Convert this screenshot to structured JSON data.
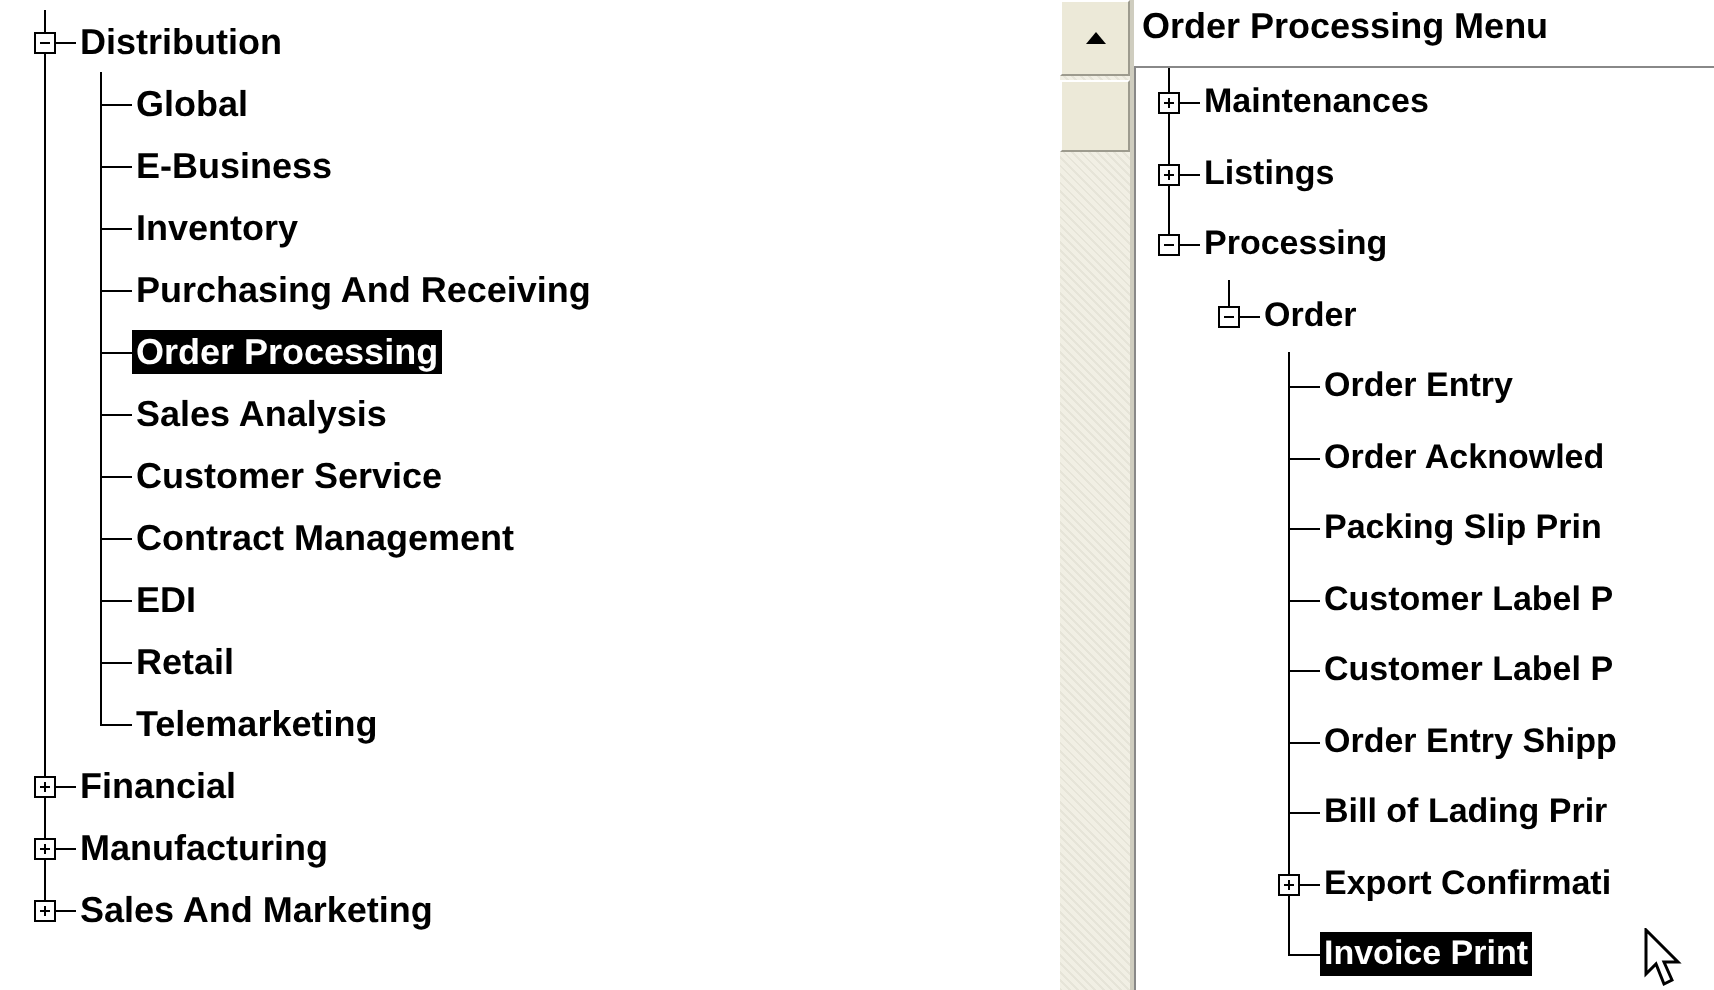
{
  "module_tree": {
    "items": [
      {
        "label": "Distribution",
        "expanded": true,
        "selected": false,
        "children": [
          {
            "label": "Global",
            "selected": false
          },
          {
            "label": "E-Business",
            "selected": false
          },
          {
            "label": "Inventory",
            "selected": false
          },
          {
            "label": "Purchasing And Receiving",
            "selected": false
          },
          {
            "label": "Order Processing",
            "selected": true
          },
          {
            "label": "Sales Analysis",
            "selected": false
          },
          {
            "label": "Customer Service",
            "selected": false
          },
          {
            "label": "Contract Management",
            "selected": false
          },
          {
            "label": "EDI",
            "selected": false
          },
          {
            "label": "Retail",
            "selected": false
          },
          {
            "label": "Telemarketing",
            "selected": false
          }
        ]
      },
      {
        "label": "Financial",
        "expanded": false,
        "selected": false
      },
      {
        "label": "Manufacturing",
        "expanded": false,
        "selected": false
      },
      {
        "label": "Sales And Marketing",
        "expanded": false,
        "selected": false
      }
    ]
  },
  "menu_panel": {
    "title": "Order Processing Menu",
    "items": [
      {
        "label": "Maintenances",
        "expanded": false,
        "selected": false
      },
      {
        "label": "Listings",
        "expanded": false,
        "selected": false
      },
      {
        "label": "Processing",
        "expanded": true,
        "selected": false,
        "children": [
          {
            "label": "Order",
            "expanded": true,
            "selected": false,
            "children": [
              {
                "label": "Order Entry",
                "selected": false
              },
              {
                "label": "Order Acknowled",
                "selected": false
              },
              {
                "label": "Packing Slip Prin",
                "selected": false
              },
              {
                "label": "Customer Label P",
                "selected": false
              },
              {
                "label": "Customer Label P",
                "selected": false
              },
              {
                "label": "Order Entry Shipp",
                "selected": false
              },
              {
                "label": "Bill of Lading Prir",
                "selected": false
              },
              {
                "label": "Export Confirmati",
                "expanded": false,
                "selected": false
              },
              {
                "label": "Invoice Print",
                "selected": true
              }
            ]
          }
        ]
      }
    ]
  }
}
